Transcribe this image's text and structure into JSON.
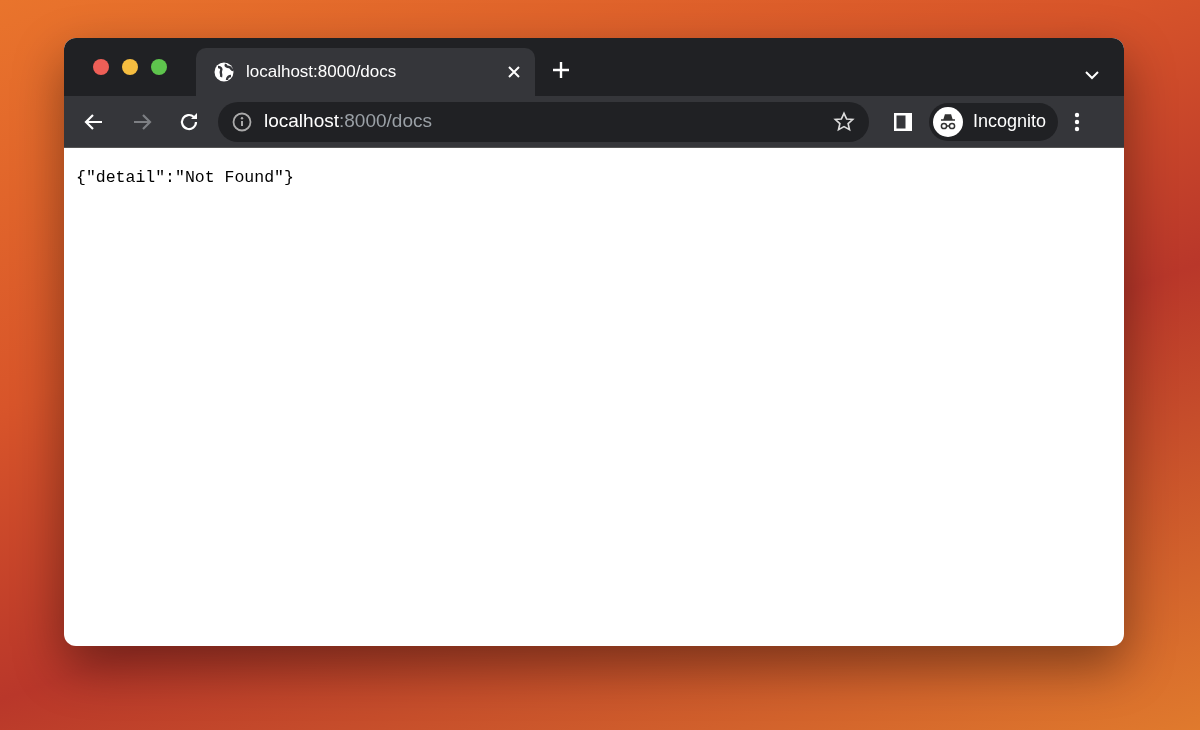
{
  "tabs": [
    {
      "title": "localhost:8000/docs",
      "selected": true
    }
  ],
  "toolbar": {
    "back_disabled": false,
    "forward_disabled": true
  },
  "address": {
    "host": "localhost",
    "rest": ":8000/docs"
  },
  "profile": {
    "label": "Incognito"
  },
  "page": {
    "body": "{\"detail\":\"Not Found\"}"
  }
}
